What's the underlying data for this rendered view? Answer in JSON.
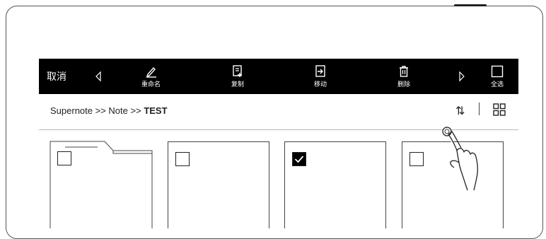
{
  "toolbar": {
    "cancel_label": "取消",
    "rename_label": "重命名",
    "copy_label": "复制",
    "move_label": "移动",
    "delete_label": "删除",
    "select_all_label": "全选"
  },
  "breadcrumb": {
    "root": "Supernote",
    "separator1": " >> ",
    "middle": "Note",
    "separator2": " >> ",
    "current": "TEST"
  },
  "cards": [
    {
      "type": "folder",
      "checked": false
    },
    {
      "type": "file",
      "checked": false
    },
    {
      "type": "file",
      "checked": true
    },
    {
      "type": "file",
      "checked": false
    }
  ],
  "icons": {
    "prev": "triangle-left-icon",
    "next": "triangle-right-icon",
    "sort": "sort-icon",
    "view": "grid-view-icon"
  }
}
